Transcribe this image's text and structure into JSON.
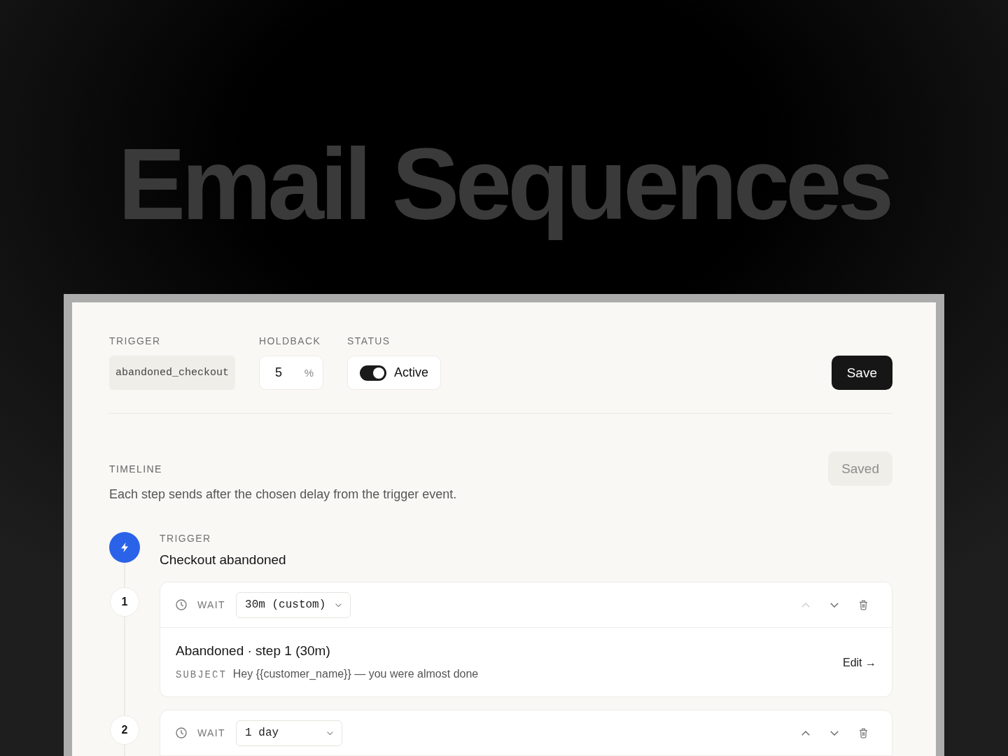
{
  "page_title": "Email Sequences",
  "settings": {
    "trigger": {
      "label": "TRIGGER",
      "value": "abandoned_checkout"
    },
    "holdback": {
      "label": "HOLDBACK",
      "value": "5",
      "unit": "%"
    },
    "status": {
      "label": "STATUS",
      "on": true,
      "text": "Active"
    },
    "save_button": "Save"
  },
  "timeline": {
    "label": "TIMELINE",
    "saved_button": {
      "text": "Saved",
      "disabled": true
    },
    "description": "Each step sends after the chosen delay from the trigger event.",
    "trigger": {
      "label": "TRIGGER",
      "event": "Checkout abandoned"
    },
    "steps": [
      {
        "number": "1",
        "wait_label": "WAIT",
        "delay": "30m (custom)",
        "move_up_disabled": true,
        "move_down_disabled": false,
        "email": {
          "name": "Abandoned · step 1 (30m)",
          "subject_label": "SUBJECT",
          "subject": "Hey {{customer_name}} — you were almost done",
          "edit_link": "Edit →"
        }
      },
      {
        "number": "2",
        "wait_label": "WAIT",
        "delay": "1 day",
        "move_up_disabled": false,
        "move_down_disabled": false
      }
    ]
  }
}
